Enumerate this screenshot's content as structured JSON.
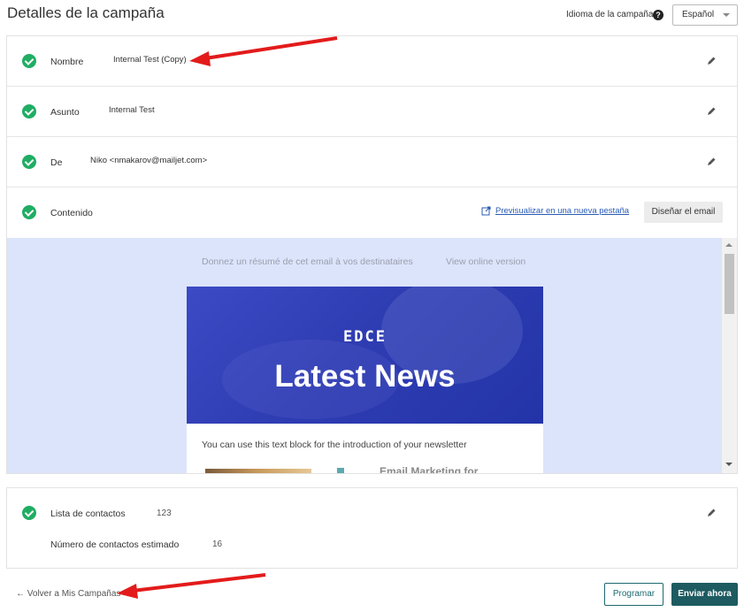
{
  "header": {
    "title": "Detalles de la campaña",
    "language_label": "Idioma de la campaña",
    "help_icon": "question-circle-icon",
    "language_value": "Español"
  },
  "rows": {
    "name": {
      "label": "Nombre",
      "value": "Internal Test (Copy)"
    },
    "subject": {
      "label": "Asunto",
      "value": "Internal Test"
    },
    "from": {
      "label": "De",
      "value": "Niko <nmakarov@mailjet.com>"
    },
    "content": {
      "label": "Contenido",
      "preview_link": "Previsualizar en una nueva pestaña",
      "design_button": "Diseñar el email"
    }
  },
  "email_preview": {
    "preheader": "Donnez un résumé de cet email à vos destinataires",
    "view_online": "View online version",
    "logo": "EDCE",
    "hero_title": "Latest News",
    "intro": "You can use this text block for the introduction of your newsletter",
    "cut_heading": "Email Marketing for"
  },
  "contacts": {
    "list_label": "Lista de contactos",
    "list_value": "123",
    "estimate_label": "Número de contactos estimado",
    "estimate_value": "16"
  },
  "footer": {
    "back_link": "Volver a Mis Campañas",
    "program_button": "Programar",
    "send_button": "Enviar ahora"
  },
  "colors": {
    "check": "#1fad63",
    "primary": "#1d5b61",
    "annotation_arrow": "#e31b1b",
    "preview_bg": "#dce4fb",
    "hero_bg": "#2f3db3"
  }
}
